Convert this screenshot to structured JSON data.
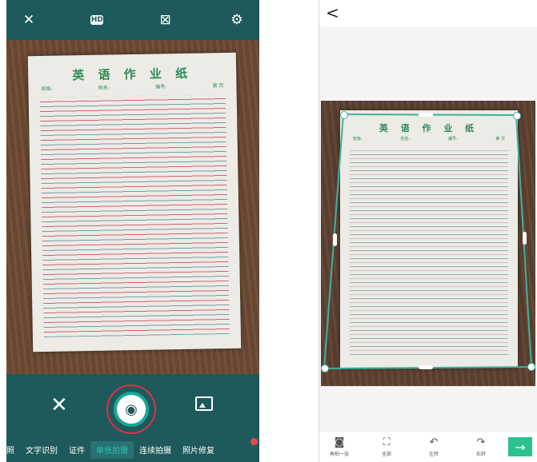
{
  "left_screen": {
    "top_icons": [
      "flash-off-icon",
      "hd-icon",
      "grid-off-icon",
      "settings-icon"
    ],
    "hd_label": "HD",
    "paper": {
      "title": "英 语 作 业 纸",
      "class_label": "班级:",
      "name_label": "姓名:",
      "number_label": "编号:",
      "page_label": "第   页"
    },
    "modes": [
      "照",
      "文字识别",
      "证件",
      "单张拍摄",
      "连续拍摄",
      "照片修复"
    ],
    "active_mode": "单张拍摄"
  },
  "right_screen": {
    "back_label": "<",
    "paper": {
      "title": "英 语 作 业 纸",
      "class_label": "班级:",
      "name_label": "姓名:",
      "number_label": "编号:",
      "page_label": "第   页"
    },
    "tools": [
      {
        "label": "再拍一张",
        "icon": "camera-icon"
      },
      {
        "label": "全部",
        "icon": "select-all-icon"
      },
      {
        "label": "左转",
        "icon": "rotate-left-icon"
      },
      {
        "label": "右转",
        "icon": "rotate-right-icon"
      }
    ],
    "next_label": "→"
  },
  "colors": {
    "teal": "#1e5a5b",
    "accent": "#29c0b0",
    "next_button": "#2cc18e",
    "shutter_ring": "#e0304a"
  }
}
